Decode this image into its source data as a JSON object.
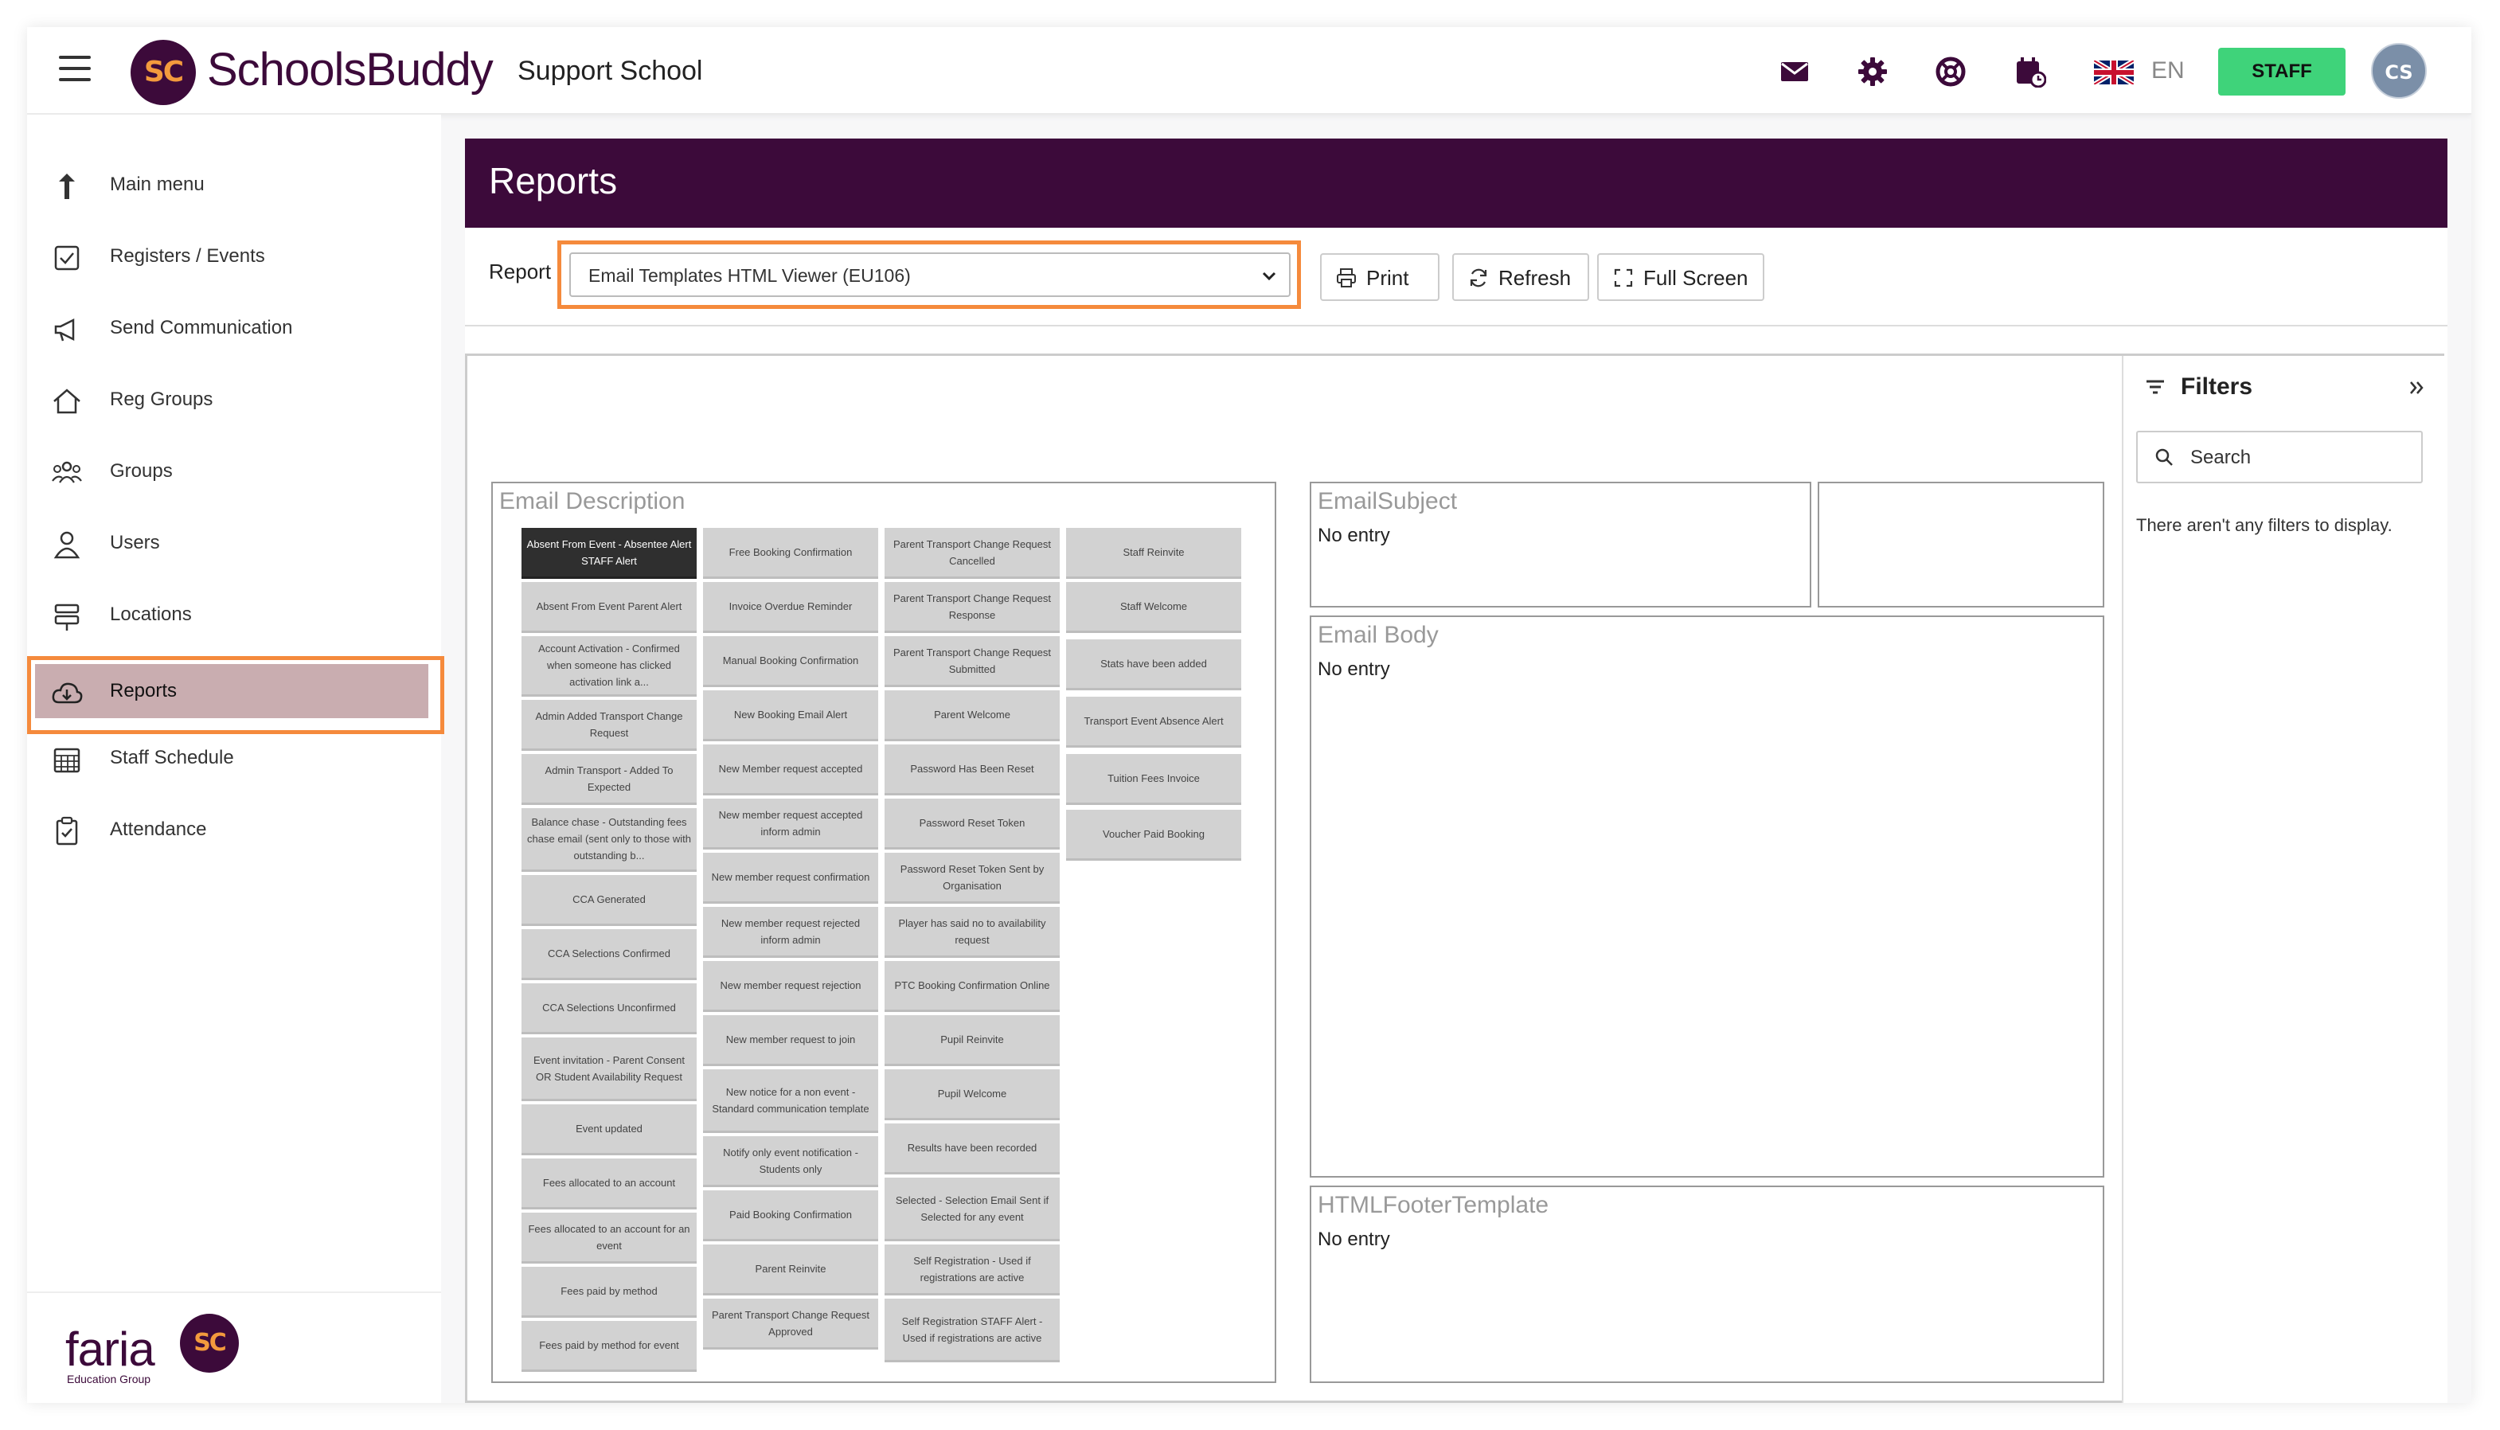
{
  "header": {
    "logo_text": "SC",
    "brand": "SchoolsBuddy",
    "school": "Support School",
    "language": "EN",
    "role_button": "STAFF",
    "avatar_initials": "CS"
  },
  "sidebar": {
    "items": [
      {
        "label": "Main menu",
        "icon": "arrow-up-icon"
      },
      {
        "label": "Registers / Events",
        "icon": "checkbox-icon"
      },
      {
        "label": "Send Communication",
        "icon": "megaphone-icon"
      },
      {
        "label": "Reg Groups",
        "icon": "house-icon"
      },
      {
        "label": "Groups",
        "icon": "people-icon"
      },
      {
        "label": "Users",
        "icon": "user-icon"
      },
      {
        "label": "Locations",
        "icon": "signpost-icon"
      },
      {
        "label": "Reports",
        "icon": "cloud-download-icon",
        "active": true
      },
      {
        "label": "Staff Schedule",
        "icon": "calendar-grid-icon"
      },
      {
        "label": "Attendance",
        "icon": "clipboard-icon"
      }
    ],
    "footer_brand": "faria",
    "footer_sub": "Education Group",
    "footer_logo": "SC"
  },
  "main": {
    "title": "Reports",
    "report_label": "Report",
    "report_selected": "Email Templates HTML Viewer (EU106)",
    "buttons": {
      "print": "Print",
      "refresh": "Refresh",
      "fullscreen": "Full Screen"
    }
  },
  "viewer": {
    "email_description_title": "Email Description",
    "email_subject_title": "EmailSubject",
    "email_subject_value": "No entry",
    "email_body_title": "Email Body",
    "email_body_value": "No entry",
    "footer_template_title": "HTMLFooterTemplate",
    "footer_template_value": "No entry",
    "templates": {
      "col1": [
        "Absent From Event - Absentee Alert STAFF Alert",
        "Absent From Event Parent Alert",
        "Account Activation - Confirmed when someone has clicked activation link a...",
        "Admin Added Transport Change Request",
        "Admin Transport - Added To Expected",
        "Balance chase - Outstanding fees chase email (sent only to those with outstanding b...",
        "CCA Generated",
        "CCA Selections Confirmed",
        "CCA Selections Unconfirmed",
        "Event invitation - Parent Consent OR Student Availability Request",
        "Event updated",
        "Fees allocated to an account",
        "Fees allocated to an account for an event",
        "Fees paid by method",
        "Fees paid by method for event"
      ],
      "col2": [
        "Free Booking Confirmation",
        "Invoice Overdue Reminder",
        "Manual Booking Confirmation",
        "New Booking Email Alert",
        "New Member request accepted",
        "New member request accepted inform admin",
        "New member request confirmation",
        "New member request rejected inform admin",
        "New member request rejection",
        "New member request to join",
        "New notice for a non event - Standard communication template",
        "Notify only event notification - Students only",
        "Paid Booking Confirmation",
        "Parent Reinvite",
        "Parent Transport Change Request Approved"
      ],
      "col3": [
        "Parent Transport Change Request Cancelled",
        "Parent Transport Change Request Response",
        "Parent Transport Change Request Submitted",
        "Parent Welcome",
        "Password Has Been Reset",
        "Password Reset Token",
        "Password Reset Token Sent by Organisation",
        "Player has said no to availability request",
        "PTC Booking Confirmation Online",
        "Pupil Reinvite",
        "Pupil Welcome",
        "Results have been recorded",
        "Selected - Selection Email Sent if Selected for any event",
        "Self Registration - Used if registrations are active",
        "Self Registration STAFF Alert - Used if registrations are active"
      ],
      "col4": [
        "Staff Reinvite",
        "Staff Welcome",
        "Stats have been added",
        "Transport Event Absence Alert",
        "Tuition Fees Invoice",
        "Voucher Paid Booking"
      ]
    }
  },
  "filters": {
    "title": "Filters",
    "search_value": "Search",
    "empty_text": "There aren't any filters to display."
  }
}
